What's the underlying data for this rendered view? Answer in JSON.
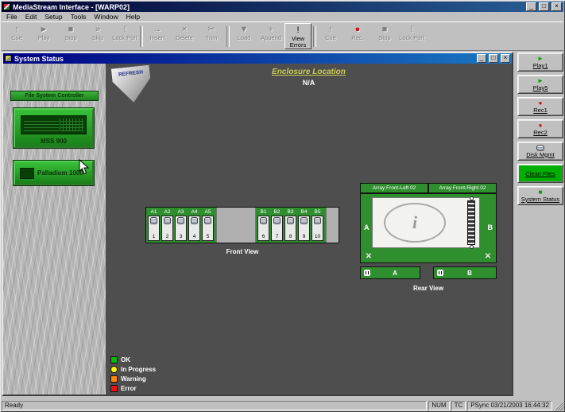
{
  "titlebar": {
    "title": "MediaStream Interface - [WARP02]",
    "minimize": "_",
    "maximize": "□",
    "close": "×"
  },
  "menubar": {
    "items": [
      "File",
      "Edit",
      "Setup",
      "Tools",
      "Window",
      "Help"
    ]
  },
  "toolbar": {
    "buttons": [
      {
        "label": "Cue",
        "glyph": "↑"
      },
      {
        "label": "Play",
        "glyph": "►"
      },
      {
        "label": "Stop",
        "glyph": "■"
      },
      {
        "label": "Skip",
        "glyph": "»"
      },
      {
        "label": "Lock Port",
        "glyph": "!"
      },
      {
        "label": "Insert",
        "glyph": "→"
      },
      {
        "label": "Delete",
        "glyph": "×"
      },
      {
        "label": "Trim",
        "glyph": "✂"
      },
      {
        "label": "Load",
        "glyph": "▼"
      },
      {
        "label": "Append",
        "glyph": "+"
      },
      {
        "label": "View Errors",
        "glyph": "!"
      },
      {
        "label": "Cue",
        "glyph": "↑"
      },
      {
        "label": "Rec.",
        "glyph": "●"
      },
      {
        "label": "Stop",
        "glyph": "■"
      },
      {
        "label": "Lock Port",
        "glyph": "!"
      }
    ]
  },
  "system_status": {
    "title": "System Status",
    "left_panel": {
      "controller_label": "File System Controller",
      "mss_label": "MSS 900",
      "palladium_label": "Palladium 1000"
    },
    "refresh_label": "REFRESH",
    "enclosure": {
      "label": "Enclosure Location",
      "value": "N/A"
    },
    "front_view": {
      "caption": "Front View",
      "slots": [
        {
          "label": "A1",
          "number": "1"
        },
        {
          "label": "A2",
          "number": "2"
        },
        {
          "label": "A3",
          "number": "3"
        },
        {
          "label": "A4",
          "number": "4"
        },
        {
          "label": "A5",
          "number": "5"
        },
        {
          "label": "B1",
          "number": "6"
        },
        {
          "label": "B2",
          "number": "7"
        },
        {
          "label": "B3",
          "number": "8"
        },
        {
          "label": "B4",
          "number": "9"
        },
        {
          "label": "B5",
          "number": "10"
        }
      ]
    },
    "rear_view": {
      "caption": "Rear View",
      "header_left": "Array Front-Left 02",
      "header_right": "Array Front-Right 02",
      "label_a": "A",
      "label_b": "B",
      "power_a": "A",
      "power_b": "B",
      "info_glyph": "i",
      "fan_glyph": "✕"
    },
    "legend": [
      {
        "label": "OK",
        "color": "#00bb00"
      },
      {
        "label": "In Progress",
        "color": "#ffff00"
      },
      {
        "label": "Warning",
        "color": "#ff8800"
      },
      {
        "label": "Error",
        "color": "#ee1111"
      }
    ]
  },
  "sidebar": {
    "buttons": [
      {
        "label": "Play1"
      },
      {
        "label": "Play5"
      },
      {
        "label": "Rec1"
      },
      {
        "label": "Rec2"
      },
      {
        "label": "Disk Mgmt"
      },
      {
        "label": "Clean Files"
      },
      {
        "label": "System Status"
      }
    ]
  },
  "colors": {
    "play": "#00a000",
    "record": "#cc1111",
    "clean_bg": "#00b000",
    "enclosure_text": "#cbcb55"
  },
  "statusbar": {
    "ready": "Ready",
    "num": "NUM",
    "tc": "TC",
    "sync": "PSync 03/21/2003 16:44:32"
  }
}
